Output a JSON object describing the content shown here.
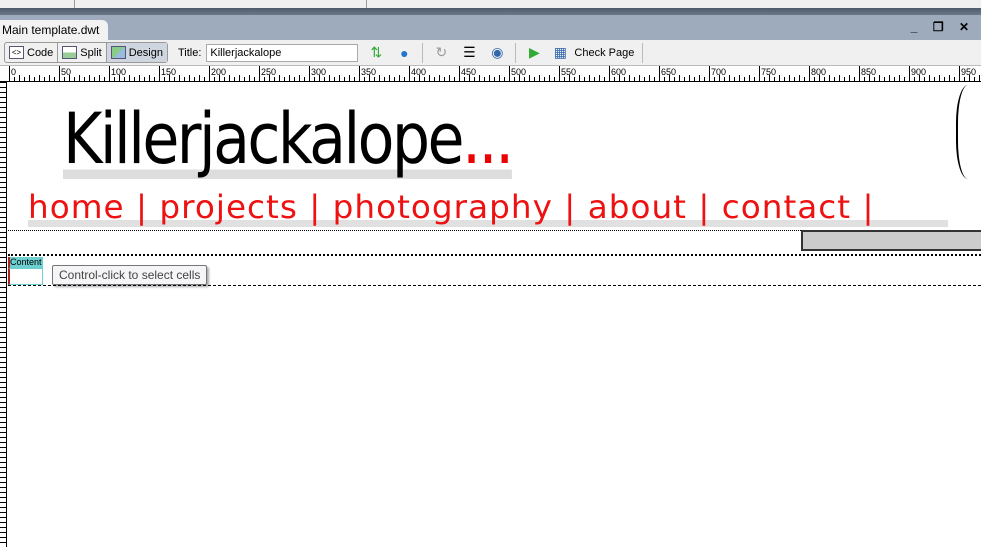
{
  "document_tab": "Main template.dwt",
  "window_controls": {
    "minimize": "_",
    "restore": "❐",
    "close": "✕"
  },
  "toolbar": {
    "code_label": "Code",
    "split_label": "Split",
    "design_label": "Design",
    "title_label": "Title:",
    "title_value": "Killerjackalope",
    "check_page_label": "Check Page"
  },
  "ruler_labels": [
    "0",
    "50",
    "100",
    "150",
    "200",
    "250",
    "300",
    "350",
    "400",
    "450",
    "500",
    "550",
    "600",
    "650",
    "700",
    "750",
    "800",
    "850",
    "900",
    "950"
  ],
  "page": {
    "logo_text": "Killerjackalope",
    "logo_dots": "...",
    "nav": [
      "home",
      "projects",
      "photography",
      "about",
      "contact"
    ],
    "nav_separator": "|",
    "region_tag": "Content",
    "tooltip": "Control-click to select cells"
  },
  "colors": {
    "accent": "#ee1111",
    "region": "#6dcfcf",
    "tabbar": "#9eabbd"
  }
}
